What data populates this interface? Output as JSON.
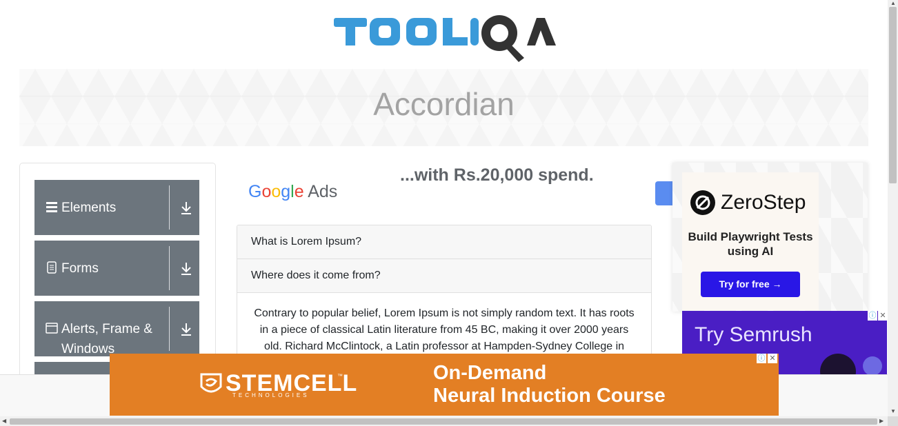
{
  "header": {
    "logo_alt": "TOOLSQA"
  },
  "banner": {
    "title": "Accordian"
  },
  "sidebar": {
    "groups": [
      {
        "label": "Elements",
        "icon": "menu-icon"
      },
      {
        "label": "Forms",
        "icon": "document-icon"
      },
      {
        "label": "Alerts, Frame & Windows",
        "icon": "window-icon"
      }
    ]
  },
  "google_ad": {
    "brand_parts": [
      "G",
      "o",
      "o",
      "g",
      "l",
      "e"
    ],
    "ads_word": "Ads",
    "headline": "...with Rs.20,000 spend."
  },
  "accordion": {
    "sections": [
      {
        "title": "What is Lorem Ipsum?"
      },
      {
        "title": "Where does it come from?"
      }
    ],
    "open_body": "Contrary to popular belief, Lorem Ipsum is not simply random text. It has roots in a piece of classical Latin literature from 45 BC, making it over 2000 years old. Richard McClintock, a Latin professor at Hampden-Sydney College in"
  },
  "zerostep_ad": {
    "name": "ZeroStep",
    "tagline": "Build Playwright Tests using AI",
    "cta": "Try for free →"
  },
  "semrush_ad": {
    "text": "Try Semrush\nfor free"
  },
  "stemcell_ad": {
    "logo": "STEMCELL",
    "tm": "™",
    "sub": "TECHNOLOGIES",
    "headline_1": "On-Demand",
    "headline_2": "Neural Induction Course"
  },
  "colors": {
    "sidebar_group": "#6c757d",
    "stemcell_bg": "#e37f24",
    "zerostep_btn": "#2917e6",
    "semrush_bg": "#4a1ec4",
    "logo_blue": "#3a9ad9",
    "logo_dark": "#333333"
  }
}
